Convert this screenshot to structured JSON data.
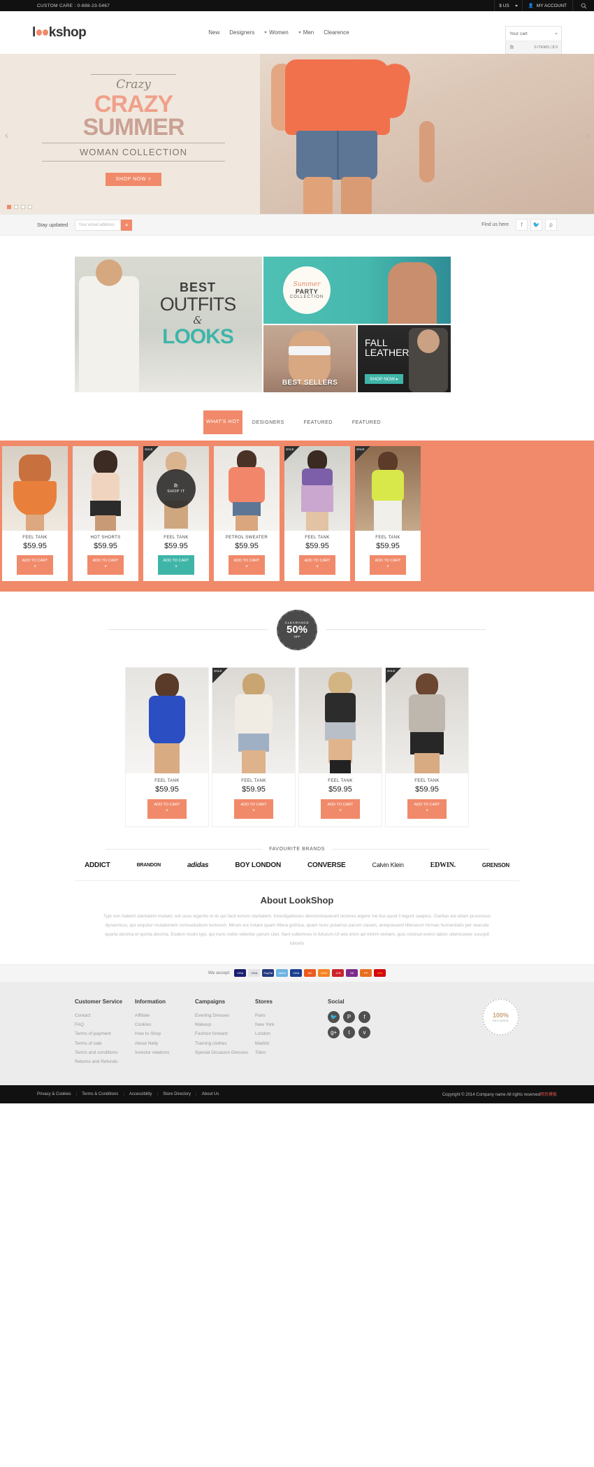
{
  "topbar": {
    "customer_care": "CUSTOM CARE : 0-888-23-5467",
    "currency": "$ US",
    "account": "MY ACCOUNT",
    "search_icon": "search-icon"
  },
  "header": {
    "logo_pre": "l",
    "logo_post": "kshop",
    "nav": [
      {
        "label": "New",
        "caret": false
      },
      {
        "label": "Designers",
        "caret": false
      },
      {
        "label": "Women",
        "caret": true
      },
      {
        "label": "Men",
        "caret": true
      },
      {
        "label": "Clearence",
        "caret": false
      }
    ],
    "cart": {
      "title": "Your cart",
      "summary": "0 ITEMS | $ 0",
      "icon": "cart-icon"
    }
  },
  "hero": {
    "script": "Crazy",
    "line1": "CRAZY",
    "line2": "SUMMER",
    "subtitle": "WOMAN COLLECTION",
    "cta": "SHOP NOW  >",
    "prev_icon": "chevron-left-icon",
    "next_icon": "chevron-right-icon",
    "slides": 4,
    "active_slide": 1
  },
  "newsletter": {
    "label": "Stay updated",
    "placeholder": "Your email address",
    "submit": "+",
    "find_us": "Find us here",
    "socials": [
      "facebook-icon",
      "twitter-icon",
      "pinterest-icon"
    ]
  },
  "promos": {
    "big": {
      "t1": "BEST",
      "t2": "OUTFITS",
      "t3": "&",
      "t4": "LOOKS"
    },
    "teal": {
      "c1": "Summer",
      "c2": "PARTY",
      "c3": "COLLECTION"
    },
    "sellers": {
      "caption": "BEST SELLERS"
    },
    "leather": {
      "line1": "FALL",
      "line2": "LEATHER",
      "button": "SHOP NOW  ▸"
    }
  },
  "tabs": [
    {
      "label": "WHAT'S HOT",
      "active": true
    },
    {
      "label": "DESIGNERS",
      "active": false
    },
    {
      "label": "FEATURED",
      "active": false
    },
    {
      "label": "FEATURED",
      "active": false
    }
  ],
  "hot_products": [
    {
      "name": "FEEL TANK",
      "price": "$59.95",
      "cta": "ADD TO CART",
      "plus": "+",
      "sale": false,
      "cta_color": "coral",
      "overlay": false
    },
    {
      "name": "HOT SHORTS",
      "price": "$59.95",
      "cta": "ADD TO CART",
      "plus": "+",
      "sale": false,
      "cta_color": "coral",
      "overlay": false
    },
    {
      "name": "FEEL TANK",
      "price": "$59.95",
      "cta": "ADD TO CART",
      "plus": "+",
      "sale": true,
      "sale_label": "SALE",
      "cta_color": "teal",
      "overlay": true,
      "overlay_label": "SHOP IT",
      "overlay_icon": "bag-icon"
    },
    {
      "name": "PETROL SWEATER",
      "price": "$59.95",
      "cta": "ADD TO CART",
      "plus": "+",
      "sale": false,
      "cta_color": "coral",
      "overlay": false
    },
    {
      "name": "FEEL TANK",
      "price": "$59.95",
      "cta": "ADD TO CART",
      "plus": "+",
      "sale": true,
      "sale_label": "SALE",
      "cta_color": "coral",
      "overlay": false
    },
    {
      "name": "FEEL TANK",
      "price": "$59.95",
      "cta": "ADD TO CART",
      "plus": "+",
      "sale": true,
      "sale_label": "SALE",
      "cta_color": "coral",
      "overlay": false
    }
  ],
  "clearance": {
    "badge_top": "CLEARANCE",
    "badge_mid": "50%",
    "badge_bot": "OFF"
  },
  "clearance_products": [
    {
      "name": "FEEL TANK",
      "price": "$59.95",
      "cta": "ADD TO CART",
      "plus": "+",
      "sale": false
    },
    {
      "name": "FEEL TANK",
      "price": "$59.95",
      "cta": "ADD TO CART",
      "plus": "+",
      "sale": true,
      "sale_label": "SALE"
    },
    {
      "name": "FEEL TANK",
      "price": "$59.95",
      "cta": "ADD TO CART",
      "plus": "+",
      "sale": false
    },
    {
      "name": "FEEL TANK",
      "price": "$59.95",
      "cta": "ADD TO CART",
      "plus": "+",
      "sale": true,
      "sale_label": "SALE"
    }
  ],
  "brands": {
    "heading": "FAVOURITE BRANDS",
    "items": [
      "ADDICT",
      "BRANDON",
      "adidas",
      "BOY LONDON",
      "CONVERSE",
      "Calvin Klein",
      "EDWIN.",
      "GRENSON"
    ]
  },
  "about": {
    "title": "About LookShop",
    "body": "Typi non habent claritatem insitam; est usus legentis in iis qui facit eorum claritatem. Investigationes demonstraverunt lectores legere me lius quod ii legunt saepius. Claritas est etiam processus dynamicus, qui sequitur mutationem consuetudium lectorum. Mirum est notare quam littera gothica, quam nunc putamus parum claram, anteposuerit litterarum formas humanitatis per seacula quarta decima et quinta decima. Eodem modo typi, qui nunc nobis videntur parum clari, fiant sollemnes in futurum.Ut wisi enim ad minim veniam, quis nostrud exerci tation ullamcorper suscipit lobortis"
  },
  "payments": {
    "label": "We accept",
    "methods": [
      "VISA",
      "VISA",
      "PayPal",
      "AMEX",
      "VISA",
      "MC",
      "Discover",
      "JCB",
      "Skrill",
      "PP",
      "DHL"
    ]
  },
  "footer": {
    "columns": [
      {
        "title": "Customer Service",
        "links": [
          "Contact",
          "FAQ",
          "Terms of payment",
          "Terms of sale",
          "Terms and conditions",
          "Returns and Refunds"
        ]
      },
      {
        "title": "Information",
        "links": [
          "Affiliate",
          "Cookies",
          "How to Shop",
          "About Nelly",
          "Investor relations"
        ]
      },
      {
        "title": "Campaigns",
        "links": [
          "Evening Dresses",
          "Makeup",
          "Fashion forward",
          "Training clothes",
          "Special Occasion Dresses"
        ]
      },
      {
        "title": "Stores",
        "links": [
          "Paris",
          "New York",
          "London",
          "Madrid",
          "Tokio"
        ]
      }
    ],
    "social_title": "Social",
    "social_icons": [
      "twitter-icon",
      "pinterest-icon",
      "facebook-icon",
      "googleplus-icon",
      "tumblr-icon",
      "vimeo-icon"
    ],
    "secured_top": "100%",
    "secured_bot": "SECURED"
  },
  "bottom": {
    "links": [
      "Privacy & Cookies",
      "Terms & Conditions",
      "Accessibility",
      "Store Directory",
      "About Us"
    ],
    "separator": "|",
    "copyright": "Copyright © 2014 Company name All rights reserved",
    "copyright_cn": "网页模板"
  },
  "colors": {
    "accent": "#f08a6a",
    "teal": "#3fb5a8",
    "dark": "#111111",
    "footer_bg": "#ececec"
  }
}
